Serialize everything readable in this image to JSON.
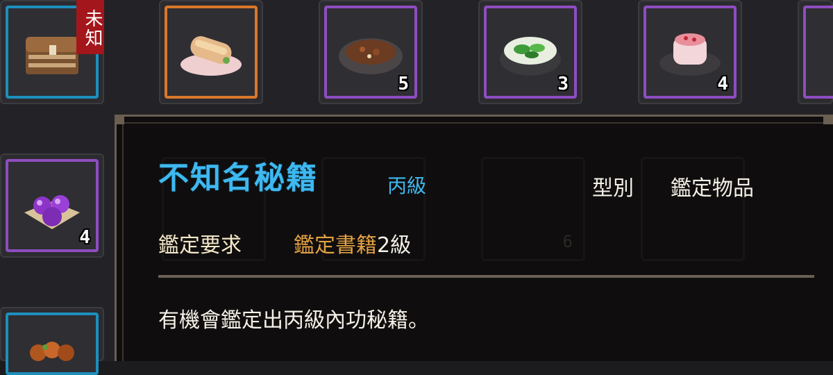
{
  "inventory": {
    "top_row": [
      {
        "frame": "cyan",
        "item_icon": "treasure-chest-icon",
        "badge": "未知",
        "count": ""
      },
      {
        "frame": "orange",
        "item_icon": "spring-roll-icon",
        "count": ""
      },
      {
        "frame": "purple",
        "item_icon": "braised-meat-bowl-icon",
        "count": "5"
      },
      {
        "frame": "purple",
        "item_icon": "green-vegetable-bowl-icon",
        "count": "3"
      },
      {
        "frame": "purple",
        "item_icon": "pink-dumpling-plate-icon",
        "count": "4"
      }
    ],
    "left_column": [
      {
        "frame": "purple",
        "item_icon": "purple-fruit-plate-icon",
        "count": "4"
      },
      {
        "frame": "cyan",
        "item_icon": "roasted-dish-icon",
        "count": ""
      }
    ],
    "ghost_count": "6"
  },
  "tooltip": {
    "name": "不知名秘籍",
    "grade": "丙級",
    "type_label": "型別",
    "type_value": "鑑定物品",
    "requirement_label": "鑑定要求",
    "requirement_value": "鑑定書籍",
    "requirement_level": "2級",
    "description": "有機會鑑定出丙級內功秘籍。"
  },
  "colors": {
    "frame_cyan": "#1d8fbd",
    "frame_orange": "#d9782a",
    "frame_purple": "#8e4dc0",
    "title_blue": "#3fb8f0",
    "requirement_orange": "#e3a243",
    "badge_red": "#a3161b"
  }
}
